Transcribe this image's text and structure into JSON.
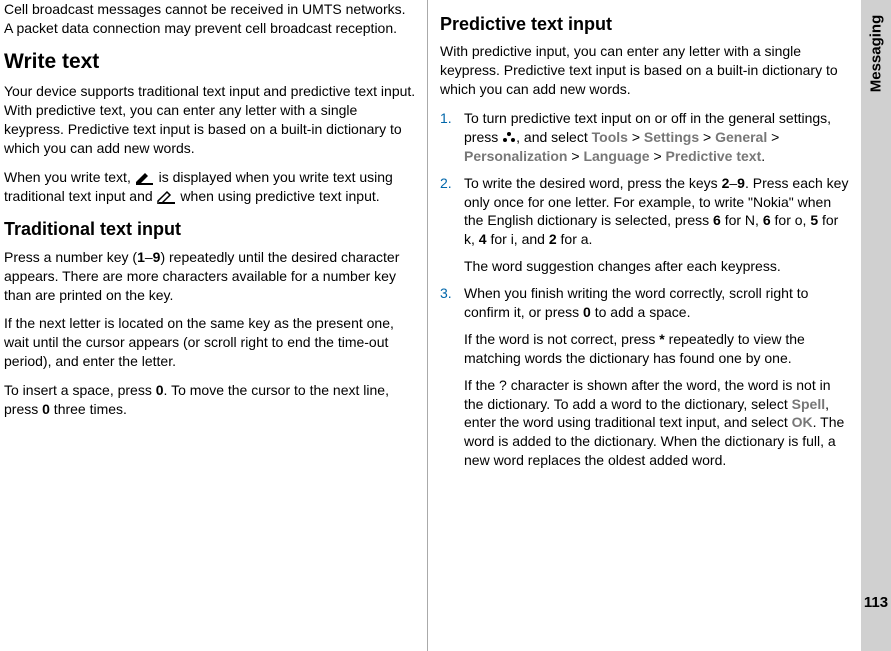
{
  "sidebar": {
    "label": "Messaging",
    "pagenum": "113"
  },
  "left": {
    "intro": "Cell broadcast messages cannot be received in UMTS networks. A packet data connection may prevent cell broadcast reception.",
    "h_write": "Write text",
    "write_p1": "Your device supports traditional text input and predictive text input. With predictive text, you can enter any letter with a single keypress. Predictive text input is based on a built-in dictionary to which you can add new words.",
    "write_p2_a": "When you write text, ",
    "write_p2_b": " is displayed when you write text using traditional text input and ",
    "write_p2_c": " when using predictive text input.",
    "h_trad": "Traditional text input",
    "trad_p1_a": "Press a number key (",
    "trad_p1_b": "1",
    "trad_p1_dash": "–",
    "trad_p1_c": "9",
    "trad_p1_d": ") repeatedly until the desired character appears. There are more characters available for a number key than are printed on the key.",
    "trad_p2": "If the next letter is located on the same key as the present one, wait until the cursor appears (or scroll right to end the time-out period), and enter the letter.",
    "trad_p3_a": "To insert a space, press ",
    "trad_p3_b": "0",
    "trad_p3_c": ". To move the cursor to the next line, press ",
    "trad_p3_d": "0",
    "trad_p3_e": " three times."
  },
  "right": {
    "h_pred": "Predictive text input",
    "pred_p1": "With predictive input, you can enter any letter with a single keypress. Predictive text input is based on a built-in dictionary to which you can add new words.",
    "li1_a": "To turn predictive text input on or off in the general settings, press ",
    "li1_b": ", and select ",
    "menu_tools": "Tools",
    "menu_settings": "Settings",
    "menu_general": "General",
    "menu_personalization": "Personalization",
    "menu_language": "Language",
    "menu_predictive": "Predictive text",
    "li2_a": "To write the desired word, press the keys ",
    "li2_b": "2",
    "li2_dash": "–",
    "li2_c": "9",
    "li2_d": ". Press each key only once for one letter. For example, to write \"Nokia\" when the English dictionary is selected, press ",
    "li2_e": "6",
    "li2_f": " for N, ",
    "li2_g": "6",
    "li2_h": " for o, ",
    "li2_i": "5",
    "li2_j": " for k, ",
    "li2_k": "4",
    "li2_l": " for i, and ",
    "li2_m": "2",
    "li2_n": " for a.",
    "li2_p2": "The word suggestion changes after each keypress.",
    "li3_a": "When you finish writing the word correctly, scroll right to confirm it, or press ",
    "li3_b": "0",
    "li3_c": " to add a space.",
    "li3_p2_a": "If the word is not correct, press ",
    "li3_p2_b": "*",
    "li3_p2_c": " repeatedly to view the matching words the dictionary has found one by one.",
    "li3_p3_a": "If the ? character is shown after the word, the word is not in the dictionary. To add a word to the dictionary, select ",
    "li3_p3_spell": "Spell",
    "li3_p3_b": ", enter the word using traditional text input, and select ",
    "li3_p3_ok": "OK",
    "li3_p3_c": ". The word is added to the dictionary. When the dictionary is full, a new word replaces the oldest added word."
  }
}
